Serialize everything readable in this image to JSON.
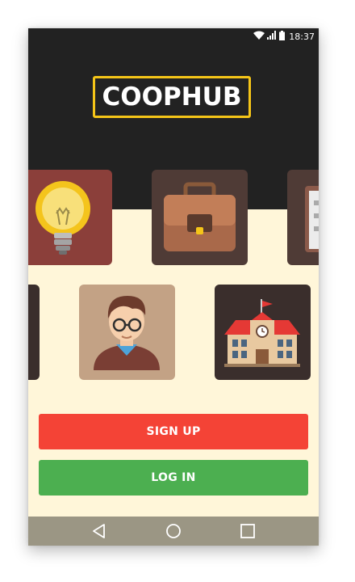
{
  "status_bar": {
    "time": "18:37",
    "icons": [
      "wifi-icon",
      "signal-icon",
      "battery-icon"
    ]
  },
  "logo": {
    "text": "COOPHUB"
  },
  "tiles": [
    {
      "name": "lightbulb-tile",
      "icon": "lightbulb-icon"
    },
    {
      "name": "briefcase-tile",
      "icon": "briefcase-icon"
    },
    {
      "name": "checklist-tile",
      "icon": "checklist-icon"
    },
    {
      "name": "partial-tile",
      "icon": "partial-icon"
    },
    {
      "name": "student-tile",
      "icon": "student-avatar-icon"
    },
    {
      "name": "school-tile",
      "icon": "school-building-icon"
    }
  ],
  "buttons": {
    "signup_label": "SIGN UP",
    "login_label": "LOG IN"
  },
  "nav_bar": {
    "items": [
      "back-icon",
      "home-icon",
      "recents-icon"
    ]
  },
  "colors": {
    "header_bg": "#222222",
    "body_bg": "#fff6d9",
    "logo_border": "#f5c518",
    "signup": "#f44336",
    "login": "#4caf50",
    "nav_bar": "#9b9684"
  }
}
